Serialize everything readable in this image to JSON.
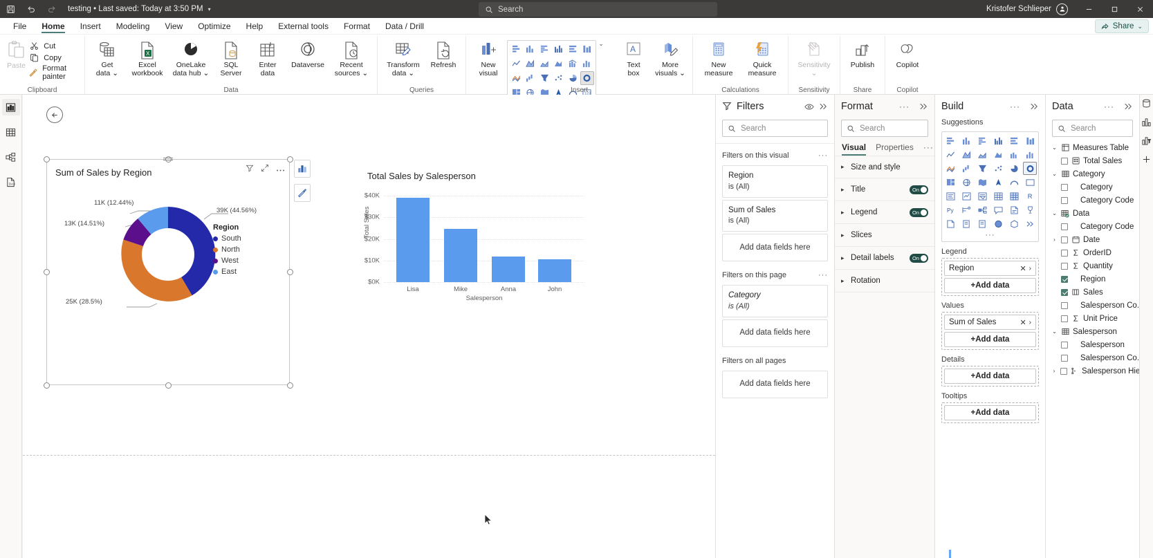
{
  "titlebar": {
    "save_icon": "save-icon",
    "undo_icon": "undo-icon",
    "redo_icon": "redo-icon",
    "doc_title": "testing  •  Last saved: Today at 3:50 PM",
    "caret": "▾",
    "search_placeholder": "Search",
    "user_name": "Kristofer Schlieper",
    "minimize": "—",
    "maximize": "⬜",
    "close": "✕"
  },
  "menubar": {
    "items": [
      {
        "label": "File",
        "active": false
      },
      {
        "label": "Home",
        "active": true
      },
      {
        "label": "Insert",
        "active": false
      },
      {
        "label": "Modeling",
        "active": false
      },
      {
        "label": "View",
        "active": false
      },
      {
        "label": "Optimize",
        "active": false
      },
      {
        "label": "Help",
        "active": false
      },
      {
        "label": "External tools",
        "active": false
      },
      {
        "label": "Format",
        "active": false
      },
      {
        "label": "Data / Drill",
        "active": false
      }
    ],
    "share_label": "Share",
    "share_caret": "⌄"
  },
  "ribbon": {
    "groups": [
      {
        "name": "Clipboard",
        "paste": "Paste",
        "items": [
          {
            "label": "Cut",
            "icon": "scissors-icon"
          },
          {
            "label": "Copy",
            "icon": "copy-icon"
          },
          {
            "label": "Format painter",
            "icon": "format-painter-icon"
          }
        ]
      },
      {
        "name": "Data",
        "buttons": [
          {
            "label": "Get\ndata ⌄",
            "icon": "get-data-icon"
          },
          {
            "label": "Excel\nworkbook",
            "icon": "excel-workbook-icon"
          },
          {
            "label": "OneLake\ndata hub ⌄",
            "icon": "onelake-icon"
          },
          {
            "label": "SQL\nServer",
            "icon": "sql-server-icon"
          },
          {
            "label": "Enter\ndata",
            "icon": "enter-data-icon"
          },
          {
            "label": "Dataverse",
            "icon": "dataverse-icon"
          },
          {
            "label": "Recent\nsources ⌄",
            "icon": "recent-sources-icon"
          }
        ]
      },
      {
        "name": "Queries",
        "buttons": [
          {
            "label": "Transform\ndata ⌄",
            "icon": "transform-data-icon"
          },
          {
            "label": "Refresh",
            "icon": "refresh-icon"
          }
        ]
      },
      {
        "name": "Insert",
        "buttons": [
          {
            "label": "New\nvisual",
            "icon": "new-visual-icon"
          },
          {
            "label": "Text\nbox",
            "icon": "text-box-icon"
          },
          {
            "label": "More\nvisuals ⌄",
            "icon": "more-visuals-icon"
          }
        ],
        "gallery_caret": "⌄"
      },
      {
        "name": "Calculations",
        "buttons": [
          {
            "label": "New\nmeasure",
            "icon": "new-measure-icon"
          },
          {
            "label": "Quick\nmeasure",
            "icon": "quick-measure-icon"
          }
        ]
      },
      {
        "name": "Sensitivity",
        "buttons": [
          {
            "label": "Sensitivity\n⌄",
            "icon": "sensitivity-icon",
            "disabled": true
          }
        ]
      },
      {
        "name": "Share",
        "buttons": [
          {
            "label": "Publish",
            "icon": "publish-icon"
          }
        ]
      },
      {
        "name": "Copilot",
        "buttons": [
          {
            "label": "Copilot",
            "icon": "copilot-icon"
          }
        ]
      }
    ]
  },
  "leftrail": {
    "items": [
      {
        "name": "report-view-icon",
        "active": true
      },
      {
        "name": "table-view-icon",
        "active": false
      },
      {
        "name": "model-view-icon",
        "active": false
      },
      {
        "name": "dax-query-view-icon",
        "active": false
      }
    ]
  },
  "canvas": {
    "back_icon": "back-arrow-icon",
    "visual_tools": [
      "filter-icon",
      "focus-mode-icon",
      "more-options-icon"
    ],
    "float_tools": [
      "visual-type-icon",
      "format-brush-icon"
    ]
  },
  "chart_data": [
    {
      "type": "pie",
      "title": "Sum of Sales by Region",
      "legend_title": "Region",
      "legend_position": "right",
      "donut": true,
      "slices": [
        {
          "label": "South",
          "value": 39,
          "percent": 44.56,
          "data_label": "39K (44.56%)",
          "color": "#2329a8"
        },
        {
          "label": "North",
          "value": 25,
          "percent": 28.5,
          "data_label": "25K (28.5%)",
          "color": "#d9782d"
        },
        {
          "label": "West",
          "value": 13,
          "percent": 14.51,
          "data_label": "13K (14.51%)",
          "color": "#5c0f8b"
        },
        {
          "label": "East",
          "value": 11,
          "percent": 12.44,
          "data_label": "11K (12.44%)",
          "color": "#5b9bed"
        }
      ]
    },
    {
      "type": "bar",
      "title": "Total Sales by Salesperson",
      "xlabel": "Salesperson",
      "ylabel": "Total Sales",
      "categories": [
        "Lisa",
        "Mike",
        "Anna",
        "John"
      ],
      "values": [
        39000,
        24500,
        12000,
        10500
      ],
      "ytick_labels": [
        "$0K",
        "$10K",
        "$20K",
        "$30K",
        "$40K"
      ],
      "ytick_values": [
        0,
        10000,
        20000,
        30000,
        40000
      ],
      "ylim": [
        0,
        40000
      ],
      "grid": true,
      "bar_color": "#5b9bed"
    }
  ],
  "filters_pane": {
    "title": "Filters",
    "icon": "filter-icon",
    "eye_icon": "eye-icon",
    "collapse_icon": "double-chevron-right-icon",
    "search_placeholder": "Search",
    "sections": [
      {
        "label": "Filters on this visual",
        "dots": "···",
        "cards": [
          {
            "field": "Region",
            "state": "is (All)",
            "italic": false
          },
          {
            "field": "Sum of Sales",
            "state": "is (All)",
            "italic": false
          }
        ],
        "drop_label": "Add data fields here"
      },
      {
        "label": "Filters on this page",
        "dots": "···",
        "cards": [
          {
            "field": "Category",
            "state": "is (All)",
            "italic": true
          }
        ],
        "drop_label": "Add data fields here"
      },
      {
        "label": "Filters on all pages",
        "dots": "",
        "cards": [],
        "drop_label": "Add data fields here"
      }
    ]
  },
  "format_pane": {
    "title": "Format",
    "search_placeholder": "Search",
    "collapse_icon": "double-chevron-right-icon",
    "dots": "···",
    "tabs": [
      {
        "label": "Visual",
        "active": true
      },
      {
        "label": "Properties",
        "active": false
      }
    ],
    "rows": [
      {
        "label": "Size and style",
        "toggle": null
      },
      {
        "label": "Title",
        "toggle": "On"
      },
      {
        "label": "Legend",
        "toggle": "On"
      },
      {
        "label": "Slices",
        "toggle": null
      },
      {
        "label": "Detail labels",
        "toggle": "On"
      },
      {
        "label": "Rotation",
        "toggle": null
      }
    ]
  },
  "build_pane": {
    "title": "Build",
    "dots": "···",
    "collapse_icon": "double-chevron-right-icon",
    "suggestions_label": "Suggestions",
    "suggestions_more": "···",
    "wells": [
      {
        "label": "Legend",
        "fields": [
          {
            "name": "Region",
            "remove": "✕",
            "expand": "›"
          }
        ],
        "add_label": "+Add data"
      },
      {
        "label": "Values",
        "fields": [
          {
            "name": "Sum of Sales",
            "remove": "✕",
            "expand": "›"
          }
        ],
        "add_label": "+Add data"
      },
      {
        "label": "Details",
        "fields": [],
        "add_label": "+Add data"
      },
      {
        "label": "Tooltips",
        "fields": [],
        "add_label": "+Add data"
      }
    ]
  },
  "data_pane": {
    "title": "Data",
    "dots": "···",
    "collapse_icon": "double-chevron-right-icon",
    "search_placeholder": "Search",
    "tree": [
      {
        "label": "Measures Table",
        "level": 0,
        "expander": "⌄",
        "icon": "measures-table-icon",
        "checkbox": false
      },
      {
        "label": "Total Sales",
        "level": 1,
        "expander": "",
        "icon": "measure-icon",
        "checkbox": true,
        "checked": false
      },
      {
        "label": "Category",
        "level": 0,
        "expander": "⌄",
        "icon": "table-icon",
        "checkbox": false
      },
      {
        "label": "Category",
        "level": 2,
        "expander": "",
        "icon": "",
        "checkbox": true,
        "checked": false
      },
      {
        "label": "Category Code",
        "level": 2,
        "expander": "",
        "icon": "",
        "checkbox": true,
        "checked": false
      },
      {
        "label": "Data",
        "level": 0,
        "expander": "⌄",
        "icon": "table-selected-icon",
        "checkbox": false
      },
      {
        "label": "Category Code",
        "level": 2,
        "expander": "",
        "icon": "",
        "checkbox": true,
        "checked": false
      },
      {
        "label": "Date",
        "level": 1,
        "expander": "›",
        "icon": "date-icon",
        "checkbox": true,
        "checked": false
      },
      {
        "label": "OrderID",
        "level": 1,
        "expander": "",
        "icon": "sigma-icon",
        "checkbox": true,
        "checked": false
      },
      {
        "label": "Quantity",
        "level": 1,
        "expander": "",
        "icon": "sigma-icon",
        "checkbox": true,
        "checked": false
      },
      {
        "label": "Region",
        "level": 2,
        "expander": "",
        "icon": "",
        "checkbox": true,
        "checked": true
      },
      {
        "label": "Sales",
        "level": 1,
        "expander": "",
        "icon": "used-field-icon",
        "checkbox": true,
        "checked": true
      },
      {
        "label": "Salesperson Co...",
        "level": 2,
        "expander": "",
        "icon": "",
        "checkbox": true,
        "checked": false
      },
      {
        "label": "Unit Price",
        "level": 1,
        "expander": "",
        "icon": "sigma-icon",
        "checkbox": true,
        "checked": false
      },
      {
        "label": "Salesperson",
        "level": 0,
        "expander": "⌄",
        "icon": "table-icon",
        "checkbox": false
      },
      {
        "label": "Salesperson",
        "level": 2,
        "expander": "",
        "icon": "",
        "checkbox": true,
        "checked": false
      },
      {
        "label": "Salesperson Co...",
        "level": 2,
        "expander": "",
        "icon": "",
        "checkbox": true,
        "checked": false
      },
      {
        "label": "Salesperson Hie...",
        "level": 1,
        "expander": "›",
        "icon": "hierarchy-icon",
        "checkbox": true,
        "checked": false
      }
    ]
  },
  "far_rail": {
    "items": [
      "data-pane-icon",
      "visualizations-pane-icon",
      "filters-pane-icon",
      "add-pane-icon"
    ]
  },
  "colors": {
    "accent": "#4a7d7a",
    "bar": "#5b9bed",
    "toggle_on": "#1f4d46"
  }
}
